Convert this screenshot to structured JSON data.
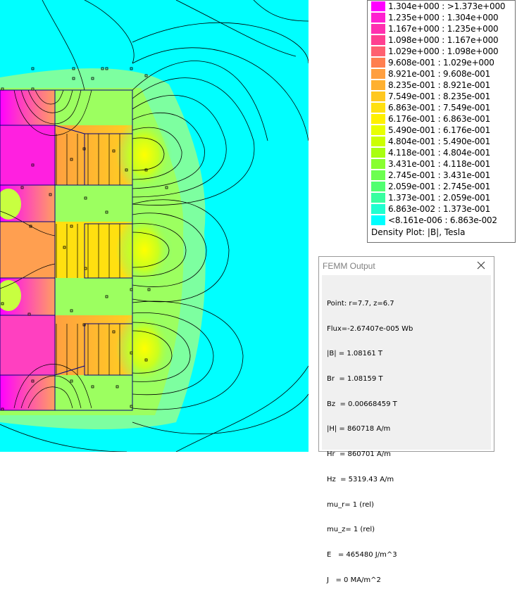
{
  "plot": {
    "background_color": "#00ffff",
    "description_colors": {
      "field_high": "#ff00ff",
      "field_mid": "#ffcc00",
      "field_low": "#80ff80"
    }
  },
  "legend": {
    "entries": [
      {
        "label": "1.304e+000 : >1.373e+000",
        "color": "#ff00ff"
      },
      {
        "label": "1.235e+000 : 1.304e+000",
        "color": "#ff20d0"
      },
      {
        "label": "1.167e+000 : 1.235e+000",
        "color": "#ff30b0"
      },
      {
        "label": "1.098e+000 : 1.167e+000",
        "color": "#ff4090"
      },
      {
        "label": "1.029e+000 : 1.098e+000",
        "color": "#ff6070"
      },
      {
        "label": "9.608e-001 : 1.029e+000",
        "color": "#ff7f50"
      },
      {
        "label": "8.921e-001 : 9.608e-001",
        "color": "#ff9f40"
      },
      {
        "label": "8.235e-001 : 8.921e-001",
        "color": "#ffb030"
      },
      {
        "label": "7.549e-001 : 8.235e-001",
        "color": "#ffc820"
      },
      {
        "label": "6.863e-001 : 7.549e-001",
        "color": "#ffe010"
      },
      {
        "label": "6.176e-001 : 6.863e-001",
        "color": "#fff000"
      },
      {
        "label": "5.490e-001 : 6.176e-001",
        "color": "#e8ff00"
      },
      {
        "label": "4.804e-001 : 5.490e-001",
        "color": "#ccff00"
      },
      {
        "label": "4.118e-001 : 4.804e-001",
        "color": "#a8ff10"
      },
      {
        "label": "3.431e-001 : 4.118e-001",
        "color": "#88ff30"
      },
      {
        "label": "2.745e-001 : 3.431e-001",
        "color": "#6cff50"
      },
      {
        "label": "2.059e-001 : 2.745e-001",
        "color": "#50ff70"
      },
      {
        "label": "1.373e-001 : 2.059e-001",
        "color": "#38ffa0"
      },
      {
        "label": "6.863e-002 : 1.373e-001",
        "color": "#20ffd0"
      },
      {
        "label": "<8.161e-006 : 6.863e-002",
        "color": "#00ffff"
      }
    ],
    "caption": "Density Plot: |B|, Tesla"
  },
  "femm_output": {
    "title": "FEMM Output",
    "close_icon": "close-icon",
    "lines": [
      "Point: r=7.7, z=6.7",
      "Flux=-2.67407e-005 Wb",
      "|B| = 1.08161 T",
      "Br  = 1.08159 T",
      "Bz  = 0.00668459 T",
      "|H| = 860718 A/m",
      "Hr  = 860701 A/m",
      "Hz  = 5319.43 A/m",
      "mu_r= 1 (rel)",
      "mu_z= 1 (rel)",
      "E   = 465480 J/m^3",
      "J   = 0 MA/m^2"
    ]
  }
}
